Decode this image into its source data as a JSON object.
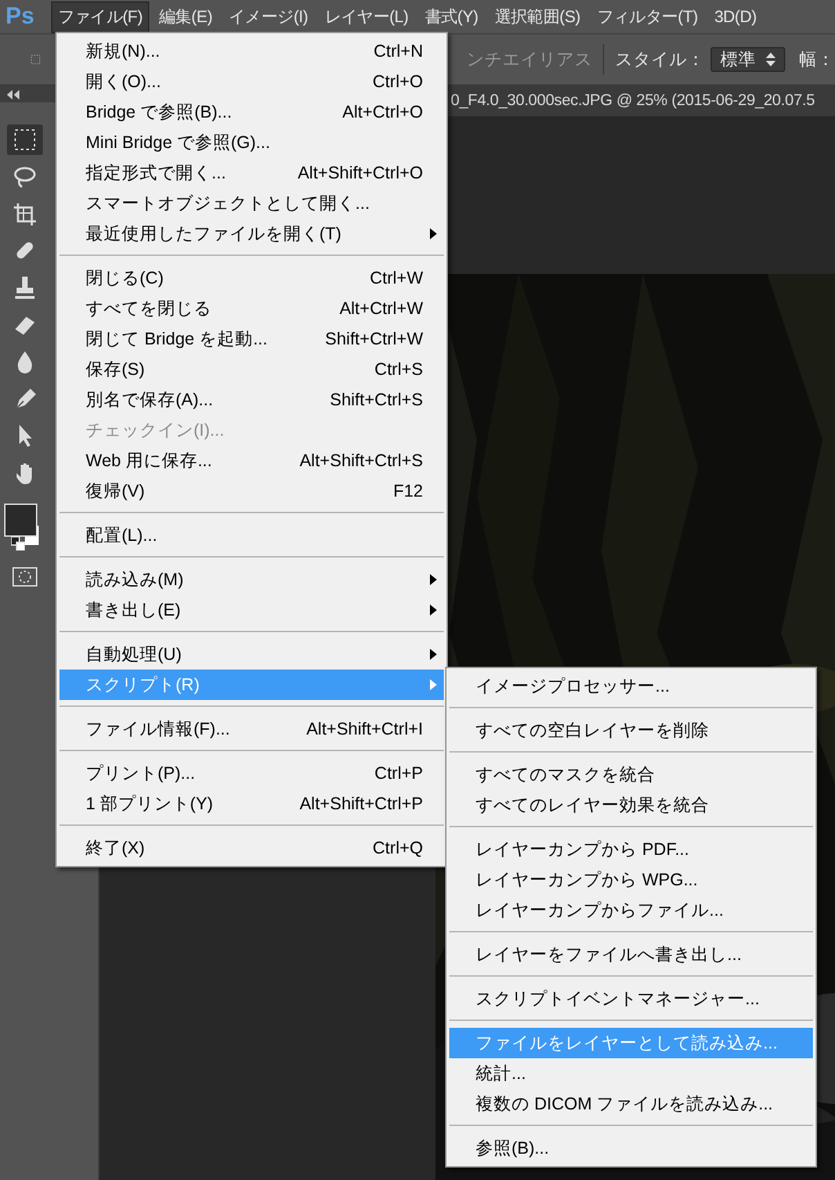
{
  "app_logo": "Ps",
  "menubar": [
    {
      "label": "ファイル(F)",
      "selected": true
    },
    {
      "label": "編集(E)",
      "selected": false
    },
    {
      "label": "イメージ(I)",
      "selected": false
    },
    {
      "label": "レイヤー(L)",
      "selected": false
    },
    {
      "label": "書式(Y)",
      "selected": false
    },
    {
      "label": "選択範囲(S)",
      "selected": false
    },
    {
      "label": "フィルター(T)",
      "selected": false
    },
    {
      "label": "3D(D)",
      "selected": false
    }
  ],
  "options_bar": {
    "antialias": "ンチエイリアス",
    "style_label": "スタイル：",
    "style_value": "標準",
    "width_label": "幅："
  },
  "document_tab": {
    "title": "0_F4.0_30.000sec.JPG @ 25% (2015-06-29_20.07.5"
  },
  "file_menu": {
    "sections": [
      [
        {
          "label": "新規(N)...",
          "shortcut": "Ctrl+N",
          "submenu": false,
          "disabled": false,
          "selected": false
        },
        {
          "label": "開く(O)...",
          "shortcut": "Ctrl+O",
          "submenu": false,
          "disabled": false,
          "selected": false
        },
        {
          "label": "Bridge で参照(B)...",
          "shortcut": "Alt+Ctrl+O",
          "submenu": false,
          "disabled": false,
          "selected": false
        },
        {
          "label": "Mini Bridge で参照(G)...",
          "submenu": false,
          "disabled": false,
          "selected": false
        },
        {
          "label": "指定形式で開く...",
          "shortcut": "Alt+Shift+Ctrl+O",
          "submenu": false,
          "disabled": false,
          "selected": false
        },
        {
          "label": "スマートオブジェクトとして開く...",
          "submenu": false,
          "disabled": false,
          "selected": false
        },
        {
          "label": "最近使用したファイルを開く(T)",
          "submenu": true,
          "disabled": false,
          "selected": false
        }
      ],
      [
        {
          "label": "閉じる(C)",
          "shortcut": "Ctrl+W",
          "submenu": false,
          "disabled": false,
          "selected": false
        },
        {
          "label": "すべてを閉じる",
          "shortcut": "Alt+Ctrl+W",
          "submenu": false,
          "disabled": false,
          "selected": false
        },
        {
          "label": "閉じて Bridge を起動...",
          "shortcut": "Shift+Ctrl+W",
          "submenu": false,
          "disabled": false,
          "selected": false
        },
        {
          "label": "保存(S)",
          "shortcut": "Ctrl+S",
          "submenu": false,
          "disabled": false,
          "selected": false
        },
        {
          "label": "別名で保存(A)...",
          "shortcut": "Shift+Ctrl+S",
          "submenu": false,
          "disabled": false,
          "selected": false
        },
        {
          "label": "チェックイン(I)...",
          "submenu": false,
          "disabled": true,
          "selected": false
        },
        {
          "label": "Web 用に保存...",
          "shortcut": "Alt+Shift+Ctrl+S",
          "submenu": false,
          "disabled": false,
          "selected": false
        },
        {
          "label": "復帰(V)",
          "shortcut": "F12",
          "submenu": false,
          "disabled": false,
          "selected": false
        }
      ],
      [
        {
          "label": "配置(L)...",
          "submenu": false,
          "disabled": false,
          "selected": false
        }
      ],
      [
        {
          "label": "読み込み(M)",
          "submenu": true,
          "disabled": false,
          "selected": false
        },
        {
          "label": "書き出し(E)",
          "submenu": true,
          "disabled": false,
          "selected": false
        }
      ],
      [
        {
          "label": "自動処理(U)",
          "submenu": true,
          "disabled": false,
          "selected": false
        },
        {
          "label": "スクリプト(R)",
          "submenu": true,
          "disabled": false,
          "selected": true
        }
      ],
      [
        {
          "label": "ファイル情報(F)...",
          "shortcut": "Alt+Shift+Ctrl+I",
          "submenu": false,
          "disabled": false,
          "selected": false
        }
      ],
      [
        {
          "label": "プリント(P)...",
          "shortcut": "Ctrl+P",
          "submenu": false,
          "disabled": false,
          "selected": false
        },
        {
          "label": "1 部プリント(Y)",
          "shortcut": "Alt+Shift+Ctrl+P",
          "submenu": false,
          "disabled": false,
          "selected": false
        }
      ],
      [
        {
          "label": "終了(X)",
          "shortcut": "Ctrl+Q",
          "submenu": false,
          "disabled": false,
          "selected": false
        }
      ]
    ]
  },
  "script_submenu": {
    "sections": [
      [
        {
          "label": "イメージプロセッサー...",
          "selected": false
        }
      ],
      [
        {
          "label": "すべての空白レイヤーを削除",
          "selected": false
        }
      ],
      [
        {
          "label": "すべてのマスクを統合",
          "selected": false
        },
        {
          "label": "すべてのレイヤー効果を統合",
          "selected": false
        }
      ],
      [
        {
          "label": "レイヤーカンプから PDF...",
          "selected": false
        },
        {
          "label": "レイヤーカンプから WPG...",
          "selected": false
        },
        {
          "label": "レイヤーカンプからファイル...",
          "selected": false
        }
      ],
      [
        {
          "label": "レイヤーをファイルへ書き出し...",
          "selected": false
        }
      ],
      [
        {
          "label": "スクリプトイベントマネージャー...",
          "selected": false
        }
      ],
      [
        {
          "label": "ファイルをレイヤーとして読み込み...",
          "selected": true
        },
        {
          "label": "統計...",
          "selected": false
        },
        {
          "label": "複数の DICOM ファイルを読み込み...",
          "selected": false
        }
      ],
      [
        {
          "label": "参照(B)...",
          "selected": false
        }
      ]
    ]
  }
}
